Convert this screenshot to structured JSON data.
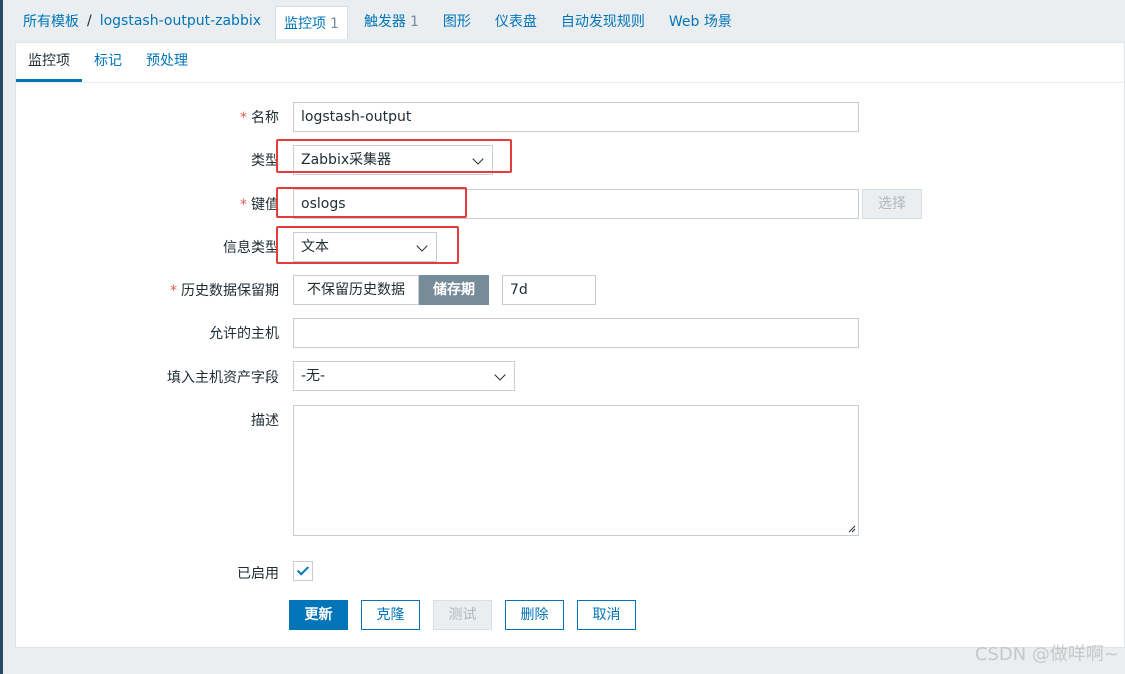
{
  "breadcrumb": {
    "all_templates": "所有模板",
    "separator": "/",
    "template_name": "logstash-output-zabbix"
  },
  "top_tabs": [
    {
      "label": "监控项",
      "count": "1",
      "active": true
    },
    {
      "label": "触发器",
      "count": "1"
    },
    {
      "label": "图形",
      "count": ""
    },
    {
      "label": "仪表盘",
      "count": ""
    },
    {
      "label": "自动发现规则",
      "count": ""
    },
    {
      "label": "Web 场景",
      "count": ""
    }
  ],
  "sub_tabs": [
    {
      "label": "监控项",
      "active": true
    },
    {
      "label": "标记"
    },
    {
      "label": "预处理"
    }
  ],
  "form": {
    "name_label": "名称",
    "name_value": "logstash-output",
    "type_label": "类型",
    "type_value": "Zabbix采集器",
    "key_label": "键值",
    "key_value": "oslogs",
    "select_button": "选择",
    "info_type_label": "信息类型",
    "info_type_value": "文本",
    "history_label": "历史数据保留期",
    "history_opt_none": "不保留历史数据",
    "history_opt_period": "储存期",
    "history_value": "7d",
    "allowed_hosts_label": "允许的主机",
    "allowed_hosts_value": "",
    "inventory_label": "填入主机资产字段",
    "inventory_value": "-无-",
    "description_label": "描述",
    "description_value": "",
    "enabled_label": "已启用",
    "enabled": true
  },
  "buttons": {
    "update": "更新",
    "clone": "克隆",
    "test": "测试",
    "delete": "删除",
    "cancel": "取消"
  },
  "watermark": "CSDN @做咩啊~",
  "colors": {
    "link": "#0275b8",
    "highlight": "#e33c3c",
    "required": "#e45959"
  }
}
